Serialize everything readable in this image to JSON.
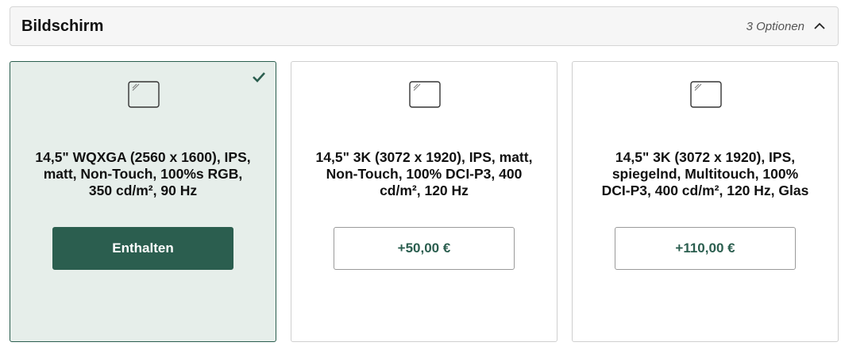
{
  "section": {
    "title": "Bildschirm",
    "options_count": "3 Optionen"
  },
  "options": [
    {
      "description": "14,5\" WQXGA (2560 x 1600), IPS, matt, Non-Touch, 100%s RGB, 350 cd/m², 90 Hz",
      "button_label": "Enthalten",
      "selected": true
    },
    {
      "description": "14,5\" 3K (3072 x 1920), IPS, matt, Non-Touch, 100% DCI-P3, 400 cd/m², 120 Hz",
      "button_label": "+50,00 €",
      "selected": false
    },
    {
      "description": "14,5\" 3K (3072 x 1920), IPS, spiegelnd, Multitouch, 100% DCI-P3, 400 cd/m², 120 Hz, Glas",
      "button_label": "+110,00 €",
      "selected": false
    }
  ],
  "colors": {
    "accent": "#2b5e4f",
    "selected_bg": "#e6eeea"
  },
  "icons": {
    "collapse": "chevron-up-icon",
    "selected": "checkmark-icon",
    "option": "display-icon"
  }
}
